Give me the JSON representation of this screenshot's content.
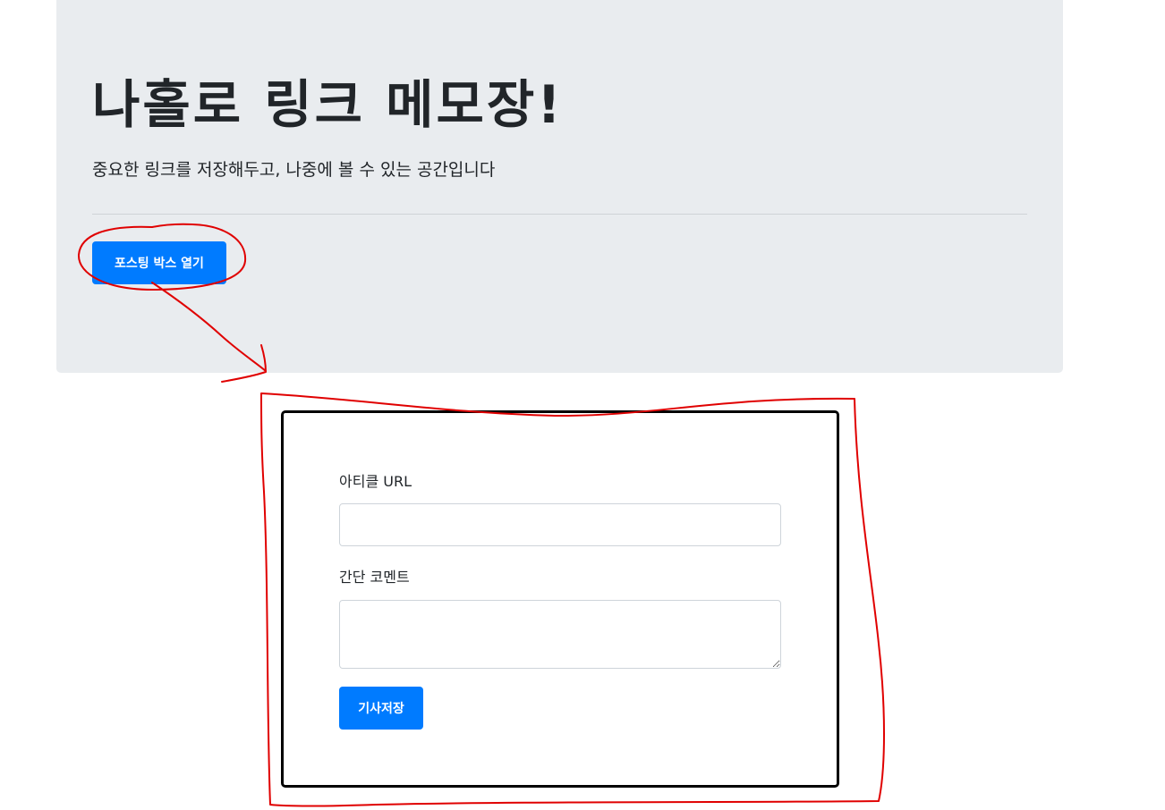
{
  "header": {
    "title": "나홀로 링크 메모장!",
    "subtitle": "중요한 링크를 저장해두고, 나중에 볼 수 있는 공간입니다",
    "open_button_label": "포스팅 박스 열기"
  },
  "post_box": {
    "url_label": "아티클 URL",
    "url_value": "",
    "comment_label": "간단 코멘트",
    "comment_value": "",
    "save_button_label": "기사저장"
  },
  "colors": {
    "jumbotron_bg": "#e9ecef",
    "primary": "#007bff",
    "annotation": "#e00000",
    "box_border": "#000000"
  }
}
